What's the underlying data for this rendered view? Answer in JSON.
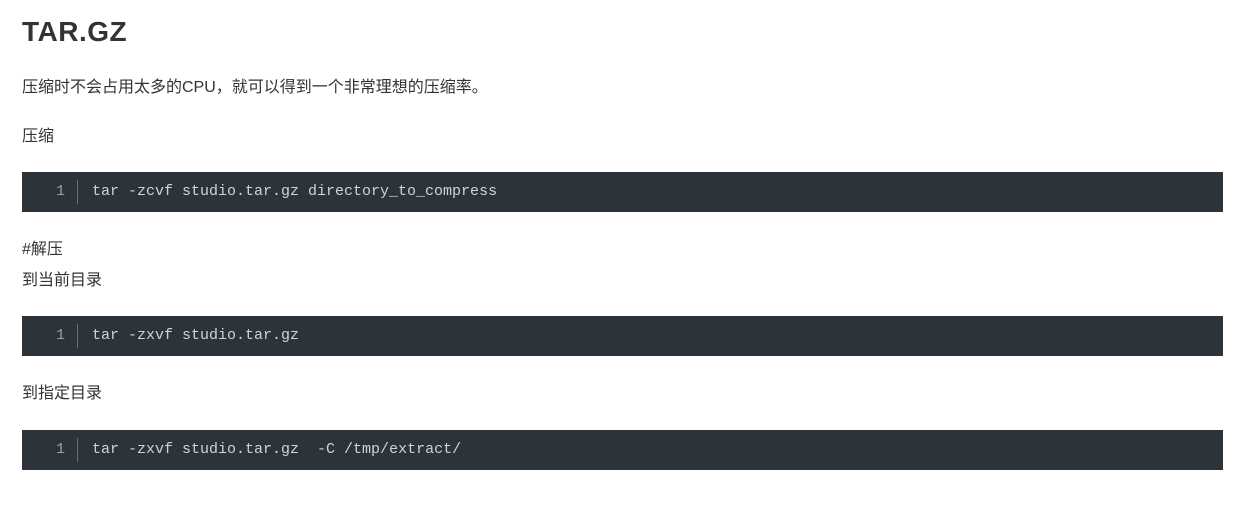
{
  "heading": "TAR.GZ",
  "intro": "压缩时不会占用太多的CPU，就可以得到一个非常理想的压缩率。",
  "label_compress": "压缩",
  "code1_lineno": "1",
  "code1": "tar -zcvf studio.tar.gz directory_to_compress",
  "label_decompress_hash": "#解压",
  "label_to_current": "到当前目录",
  "code2_lineno": "1",
  "code2": "tar -zxvf studio.tar.gz",
  "label_to_target": "到指定目录",
  "code3_lineno": "1",
  "code3_prefix": "tar -zxvf studio.tar.gz  -C ",
  "code3_seg1": "/tmp/",
  "code3_seg2": "extract",
  "code3_seg3": "/"
}
